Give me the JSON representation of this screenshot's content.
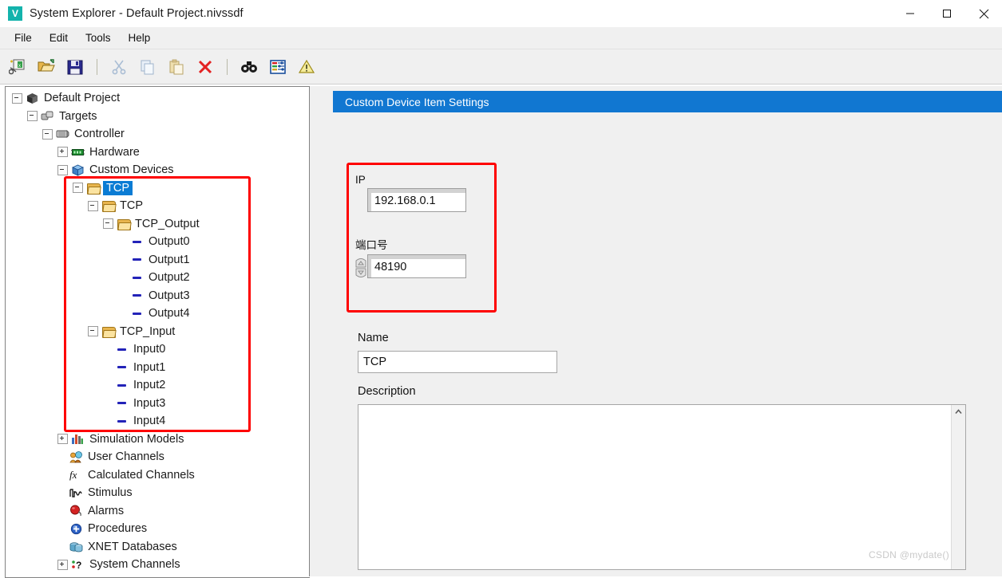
{
  "window": {
    "app_icon": "v-logo-icon",
    "title": "System Explorer - Default Project.nivssdf",
    "minimize": "minimize-icon",
    "maximize": "maximize-icon",
    "close": "close-icon"
  },
  "menubar": {
    "items": [
      {
        "label": "File"
      },
      {
        "label": "Edit"
      },
      {
        "label": "Tools"
      },
      {
        "label": "Help"
      }
    ]
  },
  "toolbar": {
    "buttons": [
      {
        "name": "new-project-icon",
        "tooltip": "New"
      },
      {
        "name": "open-folder-icon",
        "tooltip": "Open"
      },
      {
        "name": "save-icon",
        "tooltip": "Save"
      },
      {
        "name": "separator-1",
        "tooltip": ""
      },
      {
        "name": "cut-scissors-icon",
        "tooltip": "Cut"
      },
      {
        "name": "copy-icon",
        "tooltip": "Copy"
      },
      {
        "name": "paste-icon",
        "tooltip": "Paste"
      },
      {
        "name": "delete-x-icon",
        "tooltip": "Delete"
      },
      {
        "name": "separator-2",
        "tooltip": ""
      },
      {
        "name": "binoculars-find-icon",
        "tooltip": "Find"
      },
      {
        "name": "channel-list-icon",
        "tooltip": "Channels"
      },
      {
        "name": "warning-triangle-icon",
        "tooltip": "Warnings"
      }
    ]
  },
  "tree": {
    "nodes": [
      {
        "label": "Default Project",
        "indent": 0,
        "toggle": "minus",
        "icon": "project-cube-icon",
        "selected": false
      },
      {
        "label": "Targets",
        "indent": 1,
        "toggle": "minus",
        "icon": "targets-icon",
        "selected": false
      },
      {
        "label": "Controller",
        "indent": 2,
        "toggle": "minus",
        "icon": "controller-icon",
        "selected": false
      },
      {
        "label": "Hardware",
        "indent": 3,
        "toggle": "plus",
        "icon": "hardware-chip-icon",
        "selected": false
      },
      {
        "label": "Custom Devices",
        "indent": 3,
        "toggle": "minus",
        "icon": "custom-device-icon",
        "selected": false
      },
      {
        "label": "TCP",
        "indent": 4,
        "toggle": "minus",
        "icon": "folder-icon",
        "selected": true
      },
      {
        "label": "TCP",
        "indent": 5,
        "toggle": "minus",
        "icon": "folder-icon",
        "selected": false
      },
      {
        "label": "TCP_Output",
        "indent": 6,
        "toggle": "minus",
        "icon": "folder-icon",
        "selected": false
      },
      {
        "label": "Output0",
        "indent": 7,
        "toggle": "none",
        "icon": "channel-dash-icon",
        "selected": false
      },
      {
        "label": "Output1",
        "indent": 7,
        "toggle": "none",
        "icon": "channel-dash-icon",
        "selected": false
      },
      {
        "label": "Output2",
        "indent": 7,
        "toggle": "none",
        "icon": "channel-dash-icon",
        "selected": false
      },
      {
        "label": "Output3",
        "indent": 7,
        "toggle": "none",
        "icon": "channel-dash-icon",
        "selected": false
      },
      {
        "label": "Output4",
        "indent": 7,
        "toggle": "none",
        "icon": "channel-dash-icon",
        "selected": false
      },
      {
        "label": "TCP_Input",
        "indent": 5,
        "toggle": "minus",
        "icon": "folder-icon",
        "selected": false
      },
      {
        "label": "Input0",
        "indent": 6,
        "toggle": "none",
        "icon": "channel-dash-icon",
        "selected": false
      },
      {
        "label": "Input1",
        "indent": 6,
        "toggle": "none",
        "icon": "channel-dash-icon",
        "selected": false
      },
      {
        "label": "Input2",
        "indent": 6,
        "toggle": "none",
        "icon": "channel-dash-icon",
        "selected": false
      },
      {
        "label": "Input3",
        "indent": 6,
        "toggle": "none",
        "icon": "channel-dash-icon",
        "selected": false
      },
      {
        "label": "Input4",
        "indent": 6,
        "toggle": "none",
        "icon": "channel-dash-icon",
        "selected": false
      },
      {
        "label": "Simulation Models",
        "indent": 3,
        "toggle": "plus",
        "icon": "simulation-model-icon",
        "selected": false
      },
      {
        "label": "User Channels",
        "indent": 3,
        "toggle": "none",
        "icon": "user-channels-icon",
        "selected": false
      },
      {
        "label": "Calculated Channels",
        "indent": 3,
        "toggle": "none",
        "icon": "fx-function-icon",
        "selected": false
      },
      {
        "label": "Stimulus",
        "indent": 3,
        "toggle": "none",
        "icon": "stimulus-wave-icon",
        "selected": false
      },
      {
        "label": "Alarms",
        "indent": 3,
        "toggle": "none",
        "icon": "alarm-bell-icon",
        "selected": false
      },
      {
        "label": "Procedures",
        "indent": 3,
        "toggle": "none",
        "icon": "procedures-icon",
        "selected": false
      },
      {
        "label": "XNET Databases",
        "indent": 3,
        "toggle": "none",
        "icon": "database-icon",
        "selected": false
      },
      {
        "label": "System Channels",
        "indent": 3,
        "toggle": "plus",
        "icon": "system-channels-icon",
        "selected": false
      }
    ]
  },
  "settings": {
    "header_title": "Custom Device Item Settings",
    "ip": {
      "label": "IP",
      "value": "192.168.0.1"
    },
    "port": {
      "label": "端口号",
      "value": "48190",
      "increment_icon": "spinner-up-icon",
      "decrement_icon": "spinner-down-icon"
    },
    "name": {
      "label": "Name",
      "value": "TCP",
      "placeholder": ""
    },
    "description": {
      "label": "Description",
      "value": "",
      "placeholder": "",
      "scroll_up_icon": "scroll-up-arrow-icon"
    }
  },
  "annotations": {
    "highlight_color": "#fe0000",
    "tree_box_name": "tcp-tree-highlight-box",
    "ip_box_name": "ip-port-highlight-box"
  },
  "watermark": {
    "text": "CSDN @mydate()"
  },
  "colors": {
    "accent": "#1177d1",
    "selection": "#0b7cd4",
    "annotation": "#fe0000",
    "app_icon": "#13b3ac"
  }
}
